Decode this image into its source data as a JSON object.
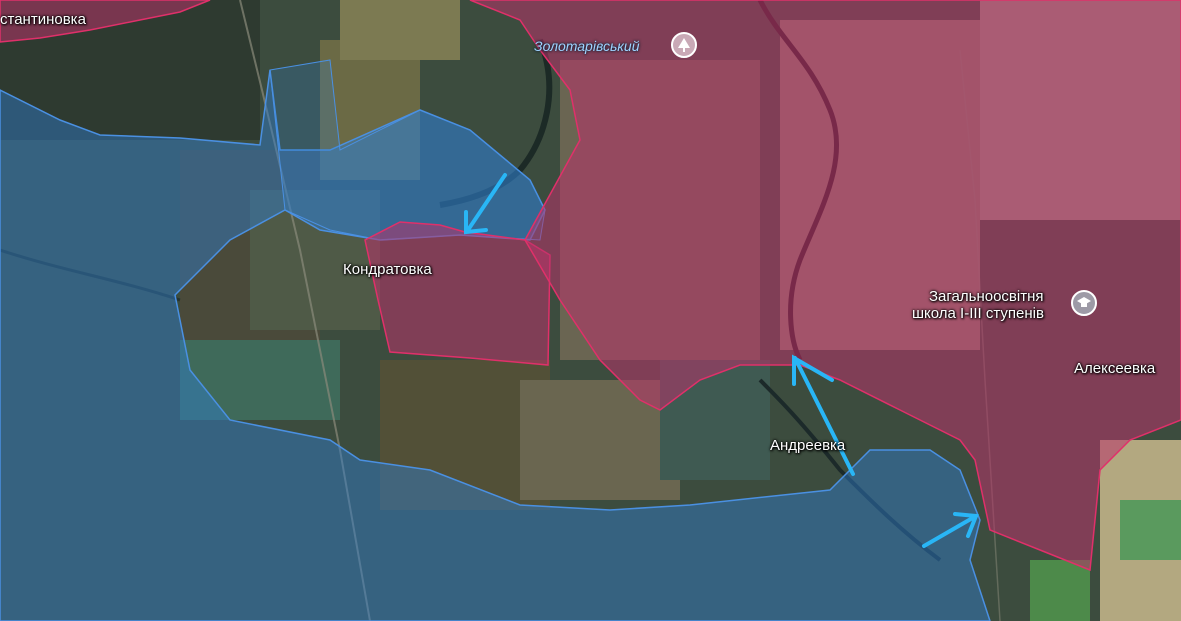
{
  "map": {
    "colors": {
      "occupied_zone": "#b8336a",
      "occupied_border": "#e0306a",
      "contested_zone": "#2f7fd0",
      "contested_border": "#4a90e2",
      "advance_arrow": "#29b6f6"
    },
    "labels": {
      "konstantinovka_partial": "стантиновка",
      "zolotarivsky": "Золотарівський",
      "kondratovka": "Кондратовка",
      "school_line1": "Загальноосвітня",
      "school_line2": "школа I-III ступенів",
      "alekseevka": "Алексеевка",
      "andreevka": "Андреевка"
    },
    "icons": {
      "park": "tree-icon",
      "school": "graduation-cap-icon"
    },
    "arrows": [
      {
        "name": "advance-arrow-kondratovka",
        "direction": "south-west"
      },
      {
        "name": "advance-arrow-andreevka",
        "direction": "north-west"
      },
      {
        "name": "advance-arrow-east",
        "direction": "north-east"
      }
    ]
  }
}
